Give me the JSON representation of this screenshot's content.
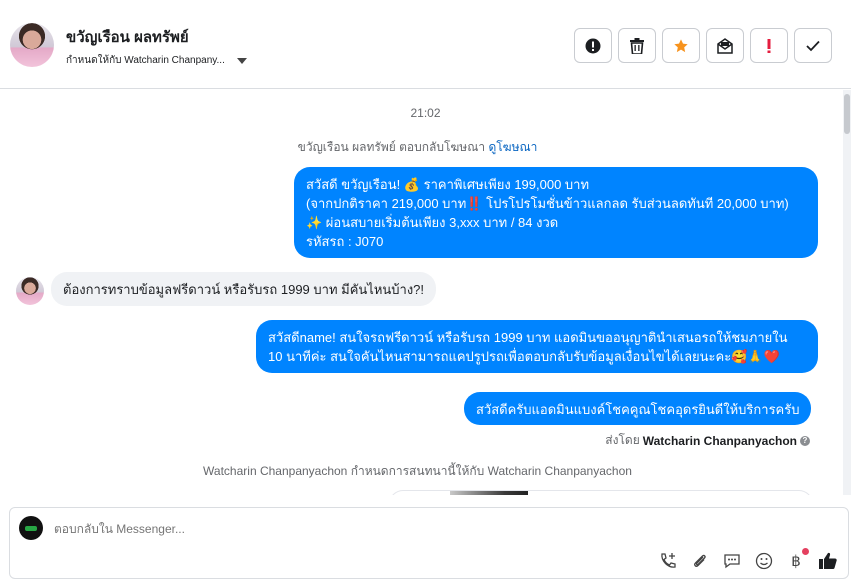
{
  "header": {
    "contact_name": "ขวัญเรือน ผลทรัพย์",
    "assigned_to": "กำหนดให้กับ Watcharin Chanpany...",
    "actions": [
      "spam",
      "delete",
      "star",
      "mark-unread",
      "follow-up",
      "done"
    ]
  },
  "conversation": {
    "time": "21:02",
    "reply_note": "ขวัญเรือน ผลทรัพย์ ตอบกลับโฆษณา",
    "reply_note_link": "ดูโฆษณา",
    "messages": [
      {
        "direction": "out",
        "lines": [
          "สวัสดี ขวัญเรือน! 💰 ราคาพิเศษเพียง 199,000 บาท",
          "(จากปกติราคา 219,000 บาท‼️ โปรโปรโมชั่นข้าวแลกลด รับส่วนลดทันที 20,000 บาท)",
          "✨ ผ่อนสบายเริ่มต้นเพียง 3,xxx บาท / 84 งวด",
          "รหัสรถ : J070"
        ]
      },
      {
        "direction": "in",
        "lines": [
          "ต้องการทราบข้อมูลฟรีดาวน์ หรือรับรถ 1999 บาท มีคันไหนบ้าง?!"
        ]
      },
      {
        "direction": "out",
        "lines": [
          "สวัสดีname! สนใจรถฟรีดาวน์ หรือรับรถ 1999 บาท แอดมินขออนุญาตินำเสนอรถให้ชมภายใน",
          "10 นาทีค่ะ สนใจคันไหนสามารถแคปรูปรถเพื่อตอบกลับรับข้อมูลเงื่อนไขได้เลยนะคะ🥰🙏❤️"
        ]
      },
      {
        "direction": "out",
        "lines": [
          "สวัสดีครับแอดมินแบงค์โชคคูณโชคอุดรยินดีให้บริการครับ"
        ]
      }
    ],
    "sent_by_label": "ส่งโดย",
    "sent_by_name": "Watcharin Chanpanyachon",
    "assign_note": "Watcharin Chanpanyachon กำหนดการสนทนานี้ให้กับ Watcharin Chanpanyachon"
  },
  "composer": {
    "placeholder": "ตอบกลับใน Messenger...",
    "tools": [
      "call-add",
      "attach",
      "saved-replies",
      "emoji",
      "payment",
      "like"
    ]
  },
  "colors": {
    "accent": "#0084ff",
    "star": "#f7931e",
    "alert": "#e41e3f"
  }
}
